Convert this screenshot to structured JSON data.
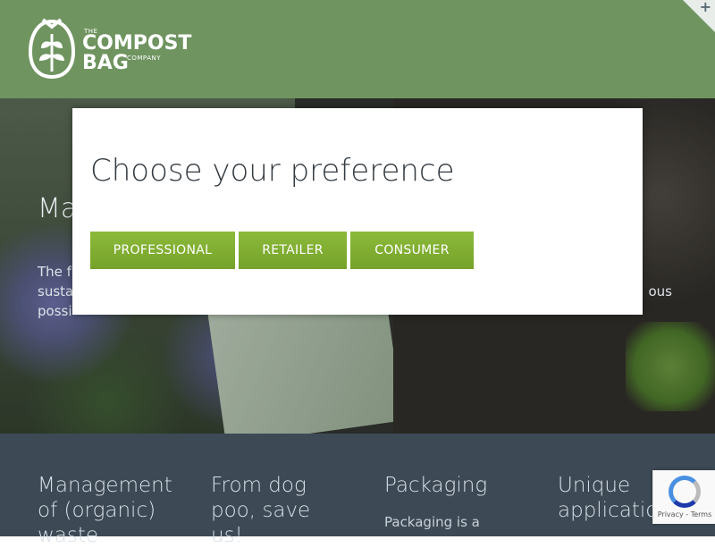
{
  "header": {
    "logo": {
      "small_top": "THE",
      "line1": "COMPOST",
      "line2": "BAG",
      "small_bottom": "COMPANY"
    },
    "corner_icon": "plus-icon"
  },
  "hero": {
    "title_visible": "Ma",
    "text_visible_lines": [
      "The f",
      "susta",
      "possi"
    ],
    "text_visible_right": "ous"
  },
  "modal": {
    "title": "Choose your preference",
    "buttons": [
      {
        "label": "PROFESSIONAL"
      },
      {
        "label": "RETAILER"
      },
      {
        "label": "CONSUMER"
      }
    ],
    "accent": "#7fae33"
  },
  "band": {
    "columns": [
      {
        "title": "Management of (organic) waste"
      },
      {
        "title": "From dog poo, save us!"
      },
      {
        "title": "Packaging",
        "text": "Packaging is a"
      },
      {
        "title": "Unique applications"
      }
    ]
  },
  "recaptcha": {
    "privacy": "Privacy",
    "terms": "Terms",
    "separator": "-"
  }
}
